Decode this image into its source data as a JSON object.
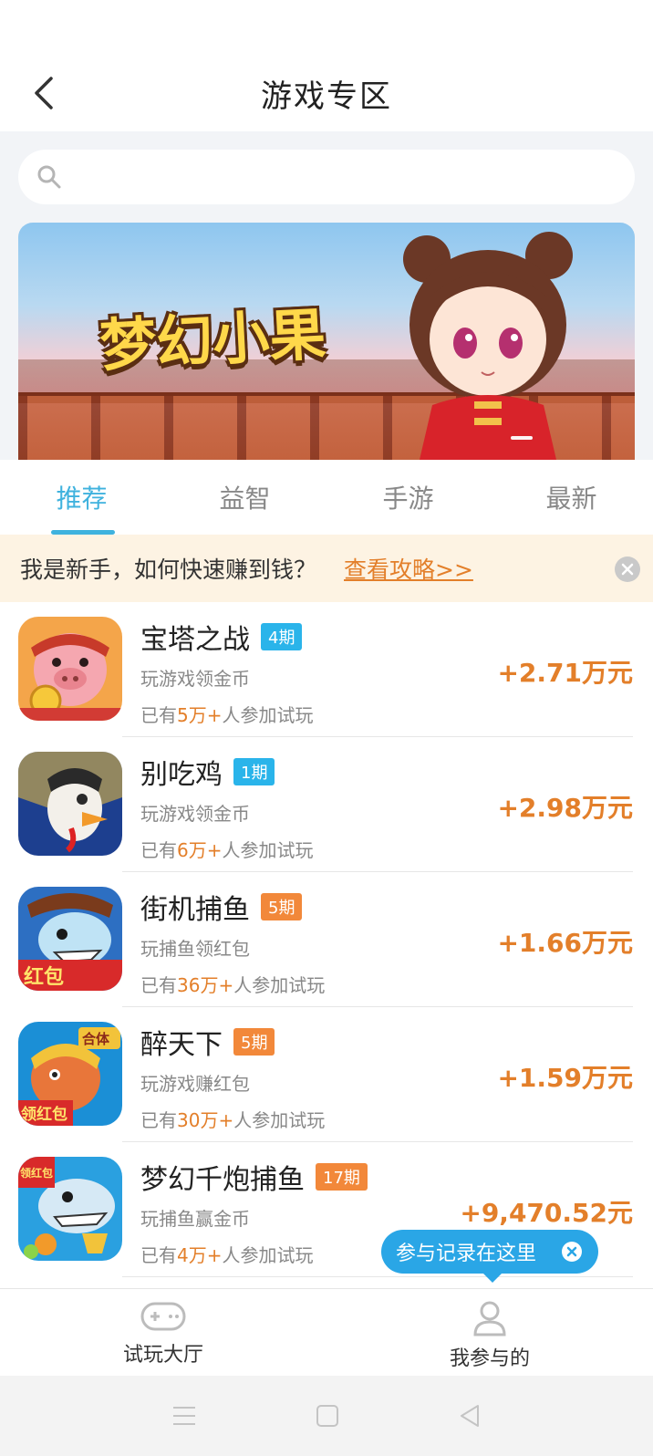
{
  "header": {
    "title": "游戏专区"
  },
  "search": {
    "placeholder": ""
  },
  "banner": {
    "logo_text": "梦幻小果"
  },
  "tabs": [
    {
      "label": "推荐",
      "active": true
    },
    {
      "label": "益智",
      "active": false
    },
    {
      "label": "手游",
      "active": false
    },
    {
      "label": "最新",
      "active": false
    }
  ],
  "notice": {
    "text": "我是新手，如何快速赚到钱？",
    "link": "查看攻略>>"
  },
  "games": [
    {
      "name": "宝塔之战",
      "badge": "4期",
      "badge_color": "#2ab4ea",
      "desc": "玩游戏领金币",
      "players_prefix": "已有",
      "players_num": "5万+",
      "players_suffix": "人参加试玩",
      "reward": "+2.71万元"
    },
    {
      "name": "别吃鸡",
      "badge": "1期",
      "badge_color": "#2ab4ea",
      "desc": "玩游戏领金币",
      "players_prefix": "已有",
      "players_num": "6万+",
      "players_suffix": "人参加试玩",
      "reward": "+2.98万元"
    },
    {
      "name": "街机捕鱼",
      "badge": "5期",
      "badge_color": "#f2883a",
      "desc": "玩捕鱼领红包",
      "players_prefix": "已有",
      "players_num": "36万+",
      "players_suffix": "人参加试玩",
      "reward": "+1.66万元"
    },
    {
      "name": "醉天下",
      "badge": "5期",
      "badge_color": "#f2883a",
      "desc": "玩游戏赚红包",
      "players_prefix": "已有",
      "players_num": "30万+",
      "players_suffix": "人参加试玩",
      "reward": "+1.59万元"
    },
    {
      "name": "梦幻千炮捕鱼",
      "badge": "17期",
      "badge_color": "#f2883a",
      "desc": "玩捕鱼赢金币",
      "players_prefix": "已有",
      "players_num": "4万+",
      "players_suffix": "人参加试玩",
      "reward": "+9,470.52元"
    }
  ],
  "tooltip": {
    "text": "参与记录在这里"
  },
  "bottom_nav": [
    {
      "label": "试玩大厅",
      "icon": "gamepad-icon"
    },
    {
      "label": "我参与的",
      "icon": "user-icon"
    }
  ],
  "colors": {
    "accent_blue": "#3fb2de",
    "reward_orange": "#e37f2a"
  }
}
